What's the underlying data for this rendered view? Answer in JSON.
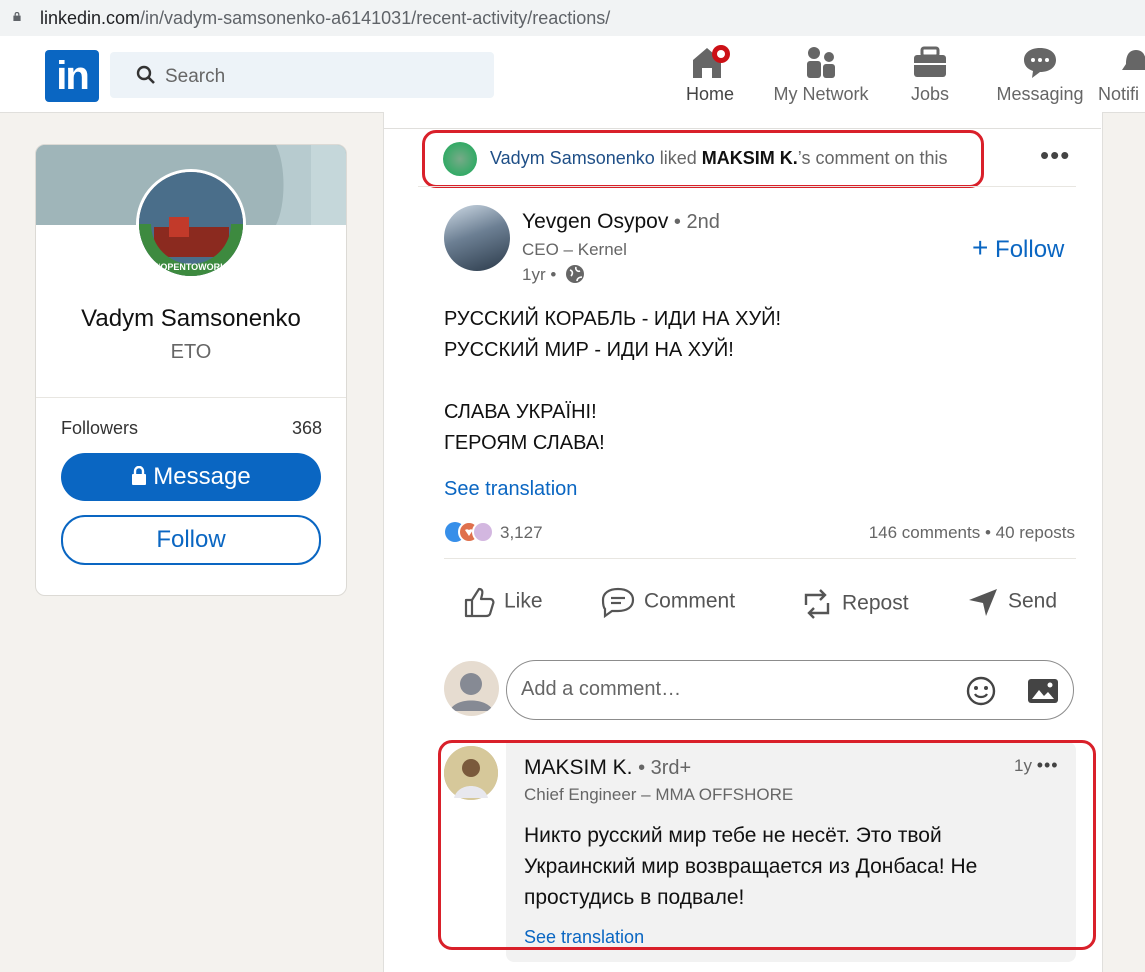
{
  "browser": {
    "url_host": "linkedin.com",
    "url_path": "/in/vadym-samsonenko-a6141031/recent-activity/reactions/"
  },
  "nav": {
    "search_placeholder": "Search",
    "items": [
      {
        "label": "Home",
        "icon": "home-icon"
      },
      {
        "label": "My Network",
        "icon": "network-icon"
      },
      {
        "label": "Jobs",
        "icon": "briefcase-icon"
      },
      {
        "label": "Messaging",
        "icon": "messaging-icon"
      },
      {
        "label": "Notifi",
        "icon": "bell-icon"
      }
    ]
  },
  "profile": {
    "name": "Vadym Samsonenko",
    "title": "ETO",
    "followers_label": "Followers",
    "followers_count": "368",
    "message_label": "Message",
    "follow_label": "Follow",
    "badge": "#OPENTOWORK"
  },
  "activity": {
    "actor": "Vadym Samsonenko",
    "verb": " liked ",
    "target": "MAKSIM K.",
    "suffix": "’s comment on this"
  },
  "post": {
    "author": "Yevgen Osypov",
    "degree": " • 2nd",
    "title": "CEO – Kernel",
    "time": "1yr •",
    "follow_label": "Follow",
    "text": "РУССКИЙ КОРАБЛЬ - ИДИ НА ХУЙ!\nРУССКИЙ МИР - ИДИ НА ХУЙ!\n\nСЛАВА УКРАЇНІ!\nГЕРОЯМ СЛАВА!",
    "see_translation": "See translation",
    "reactions_count": "3,127",
    "stats": "146 comments • 40 reposts",
    "actions": {
      "like": "Like",
      "comment": "Comment",
      "repost": "Repost",
      "send": "Send"
    }
  },
  "comment_box": {
    "placeholder": "Add a comment…"
  },
  "comment": {
    "author": "MAKSIM K.",
    "degree": " • 3rd+",
    "title": "Chief Engineer – MMA OFFSHORE",
    "time": "1y",
    "text": "Никто русский мир тебе не несёт. Это твой Украинский мир возвращается из Донбаса! Не простудись в подвале!",
    "see_translation": "See translation"
  },
  "colors": {
    "brand": "#0a66c2",
    "highlight": "#d9202a"
  }
}
